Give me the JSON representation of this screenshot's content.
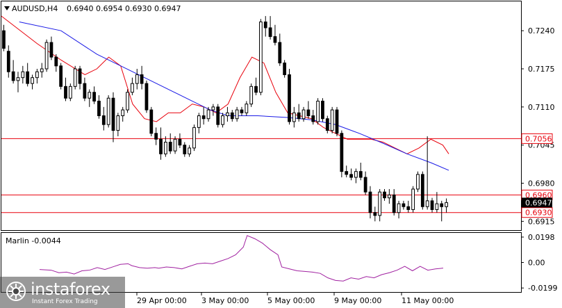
{
  "header": {
    "symbol": "AUDUSD,H4",
    "ohlc": "0.6940 0.6954 0.6930 0.6947",
    "indicator": "Marlin -0.0044"
  },
  "logo": {
    "brand": "instaforex",
    "tagline": "Instant Forex Trading"
  },
  "colors": {
    "candle": "#000000",
    "ma_fast": "#e8000b",
    "ma_slow": "#1a1ae6",
    "level": "#e8000b",
    "oscillator": "#a020a0",
    "current": "#000000"
  },
  "chart_data": [
    {
      "type": "candlestick",
      "title": "AUDUSD,H4",
      "y_ticks": [
        "0.7240",
        "0.7175",
        "0.7110",
        "0.7045",
        "0.6980",
        "0.6915"
      ],
      "x_ticks": [
        "29 Apr 00:00",
        "3 May 00:00",
        "5 May 00:00",
        "9 May 00:00",
        "11 May 00:00"
      ],
      "ylim": [
        0.69,
        0.729
      ],
      "current_price": "0.6947",
      "levels": [
        {
          "value": 0.7056,
          "label": "0.7056"
        },
        {
          "value": 0.696,
          "label": "0.6960"
        },
        {
          "value": 0.693,
          "label": "0.6930"
        }
      ],
      "candles": [
        [
          0.724,
          0.725,
          0.7205,
          0.721
        ],
        [
          0.7205,
          0.7215,
          0.716,
          0.717
        ],
        [
          0.717,
          0.719,
          0.715,
          0.7155
        ],
        [
          0.7155,
          0.717,
          0.7135,
          0.716
        ],
        [
          0.716,
          0.718,
          0.715,
          0.717
        ],
        [
          0.717,
          0.7185,
          0.7145,
          0.715
        ],
        [
          0.715,
          0.7165,
          0.714,
          0.716
        ],
        [
          0.716,
          0.7175,
          0.715,
          0.717
        ],
        [
          0.717,
          0.7185,
          0.716,
          0.7175
        ],
        [
          0.7175,
          0.7225,
          0.717,
          0.722
        ],
        [
          0.722,
          0.723,
          0.719,
          0.7195
        ],
        [
          0.7195,
          0.72,
          0.717,
          0.718
        ],
        [
          0.718,
          0.7185,
          0.714,
          0.7145
        ],
        [
          0.7145,
          0.716,
          0.712,
          0.7125
        ],
        [
          0.7125,
          0.715,
          0.712,
          0.7145
        ],
        [
          0.7145,
          0.718,
          0.714,
          0.7175
        ],
        [
          0.7175,
          0.718,
          0.714,
          0.715
        ],
        [
          0.715,
          0.716,
          0.712,
          0.7125
        ],
        [
          0.7125,
          0.714,
          0.711,
          0.7135
        ],
        [
          0.7135,
          0.7145,
          0.7115,
          0.712
        ],
        [
          0.712,
          0.713,
          0.709,
          0.7095
        ],
        [
          0.7095,
          0.711,
          0.707,
          0.708
        ],
        [
          0.708,
          0.713,
          0.7075,
          0.7125
        ],
        [
          0.7125,
          0.7135,
          0.705,
          0.707
        ],
        [
          0.707,
          0.71,
          0.706,
          0.7095
        ],
        [
          0.7095,
          0.711,
          0.7085,
          0.7105
        ],
        [
          0.7105,
          0.714,
          0.71,
          0.7135
        ],
        [
          0.7135,
          0.716,
          0.713,
          0.715
        ],
        [
          0.715,
          0.7175,
          0.714,
          0.7165
        ],
        [
          0.7165,
          0.718,
          0.714,
          0.715
        ],
        [
          0.715,
          0.7155,
          0.71,
          0.7105
        ],
        [
          0.7105,
          0.711,
          0.706,
          0.7065
        ],
        [
          0.7065,
          0.7075,
          0.7045,
          0.7055
        ],
        [
          0.7055,
          0.7075,
          0.702,
          0.703
        ],
        [
          0.703,
          0.706,
          0.7025,
          0.705
        ],
        [
          0.705,
          0.7065,
          0.703,
          0.7035
        ],
        [
          0.7035,
          0.706,
          0.703,
          0.7055
        ],
        [
          0.7055,
          0.7065,
          0.704,
          0.7045
        ],
        [
          0.7045,
          0.705,
          0.7025,
          0.703
        ],
        [
          0.703,
          0.7045,
          0.7025,
          0.704
        ],
        [
          0.704,
          0.708,
          0.7035,
          0.7075
        ],
        [
          0.7075,
          0.71,
          0.7065,
          0.7095
        ],
        [
          0.7095,
          0.711,
          0.708,
          0.709
        ],
        [
          0.709,
          0.711,
          0.7085,
          0.7105
        ],
        [
          0.7105,
          0.7115,
          0.7095,
          0.711
        ],
        [
          0.711,
          0.7115,
          0.7075,
          0.708
        ],
        [
          0.708,
          0.71,
          0.7075,
          0.7095
        ],
        [
          0.7095,
          0.711,
          0.7085,
          0.71
        ],
        [
          0.71,
          0.7105,
          0.7085,
          0.709
        ],
        [
          0.709,
          0.711,
          0.7085,
          0.7105
        ],
        [
          0.7105,
          0.711,
          0.7095,
          0.71
        ],
        [
          0.71,
          0.712,
          0.7095,
          0.7115
        ],
        [
          0.7115,
          0.715,
          0.711,
          0.7145
        ],
        [
          0.7145,
          0.716,
          0.713,
          0.7135
        ],
        [
          0.7135,
          0.726,
          0.713,
          0.7255
        ],
        [
          0.7255,
          0.7265,
          0.723,
          0.7245
        ],
        [
          0.7245,
          0.7265,
          0.7225,
          0.723
        ],
        [
          0.723,
          0.725,
          0.7215,
          0.722
        ],
        [
          0.722,
          0.7235,
          0.718,
          0.7185
        ],
        [
          0.7185,
          0.719,
          0.716,
          0.7165
        ],
        [
          0.7165,
          0.7175,
          0.708,
          0.7085
        ],
        [
          0.7085,
          0.711,
          0.7075,
          0.71
        ],
        [
          0.71,
          0.7115,
          0.7085,
          0.709
        ],
        [
          0.709,
          0.711,
          0.7085,
          0.7105
        ],
        [
          0.7105,
          0.712,
          0.709,
          0.7095
        ],
        [
          0.7095,
          0.7105,
          0.708,
          0.7085
        ],
        [
          0.7085,
          0.7125,
          0.708,
          0.712
        ],
        [
          0.712,
          0.7125,
          0.7085,
          0.709
        ],
        [
          0.709,
          0.7095,
          0.7065,
          0.707
        ],
        [
          0.707,
          0.711,
          0.7065,
          0.7105
        ],
        [
          0.7105,
          0.711,
          0.706,
          0.7065
        ],
        [
          0.7065,
          0.707,
          0.699,
          0.7
        ],
        [
          0.7,
          0.701,
          0.699,
          0.6995
        ],
        [
          0.6995,
          0.7005,
          0.6985,
          0.699
        ],
        [
          0.699,
          0.7005,
          0.698,
          0.7
        ],
        [
          0.7,
          0.7015,
          0.6985,
          0.699
        ],
        [
          0.699,
          0.7,
          0.696,
          0.6965
        ],
        [
          0.6965,
          0.6975,
          0.692,
          0.693
        ],
        [
          0.693,
          0.694,
          0.6915,
          0.6925
        ],
        [
          0.6925,
          0.697,
          0.6915,
          0.6965
        ],
        [
          0.6965,
          0.697,
          0.695,
          0.6955
        ],
        [
          0.6955,
          0.697,
          0.6945,
          0.696
        ],
        [
          0.696,
          0.697,
          0.6925,
          0.693
        ],
        [
          0.693,
          0.695,
          0.692,
          0.6945
        ],
        [
          0.6945,
          0.695,
          0.6935,
          0.694
        ],
        [
          0.694,
          0.695,
          0.693,
          0.6935
        ],
        [
          0.6935,
          0.6975,
          0.693,
          0.697
        ],
        [
          0.697,
          0.7,
          0.6965,
          0.6995
        ],
        [
          0.6995,
          0.7,
          0.6935,
          0.694
        ],
        [
          0.694,
          0.706,
          0.6935,
          0.695
        ],
        [
          0.695,
          0.6955,
          0.693,
          0.6935
        ],
        [
          0.6935,
          0.6965,
          0.693,
          0.6945
        ],
        [
          0.6945,
          0.695,
          0.6915,
          0.694
        ],
        [
          0.694,
          0.6954,
          0.693,
          0.6947
        ]
      ],
      "ma_fast": [
        [
          0,
          0.7265
        ],
        [
          12,
          0.7218
        ],
        [
          20,
          0.719
        ],
        [
          28,
          0.7165
        ],
        [
          32,
          0.7175
        ],
        [
          36,
          0.7195
        ],
        [
          40,
          0.718
        ],
        [
          44,
          0.7115
        ],
        [
          48,
          0.709
        ],
        [
          52,
          0.7085
        ],
        [
          56,
          0.71
        ],
        [
          60,
          0.71
        ],
        [
          64,
          0.7115
        ],
        [
          68,
          0.711
        ],
        [
          72,
          0.71
        ],
        [
          76,
          0.7115
        ],
        [
          80,
          0.716
        ],
        [
          84,
          0.7195
        ],
        [
          88,
          0.7185
        ],
        [
          92,
          0.7135
        ],
        [
          96,
          0.71
        ],
        [
          100,
          0.7095
        ],
        [
          104,
          0.709
        ],
        [
          108,
          0.7075
        ],
        [
          112,
          0.7065
        ],
        [
          116,
          0.7055
        ],
        [
          120,
          0.7055
        ],
        [
          124,
          0.7055
        ],
        [
          128,
          0.705
        ],
        [
          132,
          0.704
        ],
        [
          136,
          0.703
        ],
        [
          140,
          0.704
        ],
        [
          144,
          0.7055
        ],
        [
          148,
          0.7045
        ],
        [
          150,
          0.703
        ]
      ],
      "ma_slow": [
        [
          6,
          0.7255
        ],
        [
          20,
          0.724
        ],
        [
          32,
          0.72
        ],
        [
          44,
          0.717
        ],
        [
          56,
          0.714
        ],
        [
          64,
          0.712
        ],
        [
          70,
          0.7105
        ],
        [
          76,
          0.7095
        ],
        [
          86,
          0.7095
        ],
        [
          96,
          0.7092
        ],
        [
          104,
          0.7088
        ],
        [
          112,
          0.708
        ],
        [
          120,
          0.7065
        ],
        [
          128,
          0.7048
        ],
        [
          136,
          0.703
        ],
        [
          144,
          0.7015
        ],
        [
          150,
          0.7002
        ]
      ]
    },
    {
      "type": "line",
      "title": "Marlin -0.0044",
      "y_ticks": [
        "0.0198",
        "0.00",
        "-0.0199"
      ],
      "ylim": [
        -0.0225,
        0.0225
      ],
      "series": [
        {
          "values": [
            [
              0,
              -0.0055
            ],
            [
              6,
              -0.006
            ],
            [
              10,
              -0.008
            ],
            [
              14,
              -0.0075
            ],
            [
              18,
              -0.009
            ],
            [
              22,
              -0.0065
            ],
            [
              26,
              -0.006
            ],
            [
              30,
              -0.004
            ],
            [
              34,
              -0.0055
            ],
            [
              38,
              -0.0035
            ],
            [
              42,
              -0.0015
            ],
            [
              46,
              -0.001
            ],
            [
              48,
              -0.0025
            ],
            [
              52,
              -0.004
            ],
            [
              56,
              -0.0045
            ],
            [
              60,
              -0.004
            ],
            [
              62,
              -0.0045
            ],
            [
              66,
              -0.0035
            ],
            [
              70,
              -0.004
            ],
            [
              74,
              -0.005
            ],
            [
              78,
              -0.003
            ],
            [
              82,
              -0.001
            ],
            [
              86,
              -0.0005
            ],
            [
              90,
              -0.001
            ],
            [
              94,
              0.001
            ],
            [
              98,
              0.003
            ],
            [
              102,
              0.006
            ],
            [
              106,
              0.012
            ],
            [
              108,
              0.021
            ],
            [
              112,
              0.0185
            ],
            [
              116,
              0.015
            ],
            [
              120,
              0.01
            ],
            [
              124,
              0.006
            ],
            [
              126,
              -0.0035
            ],
            [
              130,
              -0.005
            ],
            [
              134,
              -0.0065
            ],
            [
              138,
              -0.007
            ],
            [
              142,
              -0.0075
            ],
            [
              146,
              -0.0085
            ],
            [
              150,
              -0.012
            ],
            [
              154,
              -0.014
            ],
            [
              158,
              -0.0145
            ],
            [
              162,
              -0.012
            ],
            [
              166,
              -0.013
            ],
            [
              170,
              -0.011
            ],
            [
              174,
              -0.012
            ],
            [
              178,
              -0.0095
            ],
            [
              182,
              -0.008
            ],
            [
              186,
              -0.006
            ],
            [
              190,
              -0.003
            ],
            [
              194,
              -0.0065
            ],
            [
              198,
              -0.003
            ],
            [
              202,
              -0.006
            ],
            [
              206,
              -0.005
            ],
            [
              210,
              -0.0044
            ]
          ]
        }
      ]
    }
  ]
}
